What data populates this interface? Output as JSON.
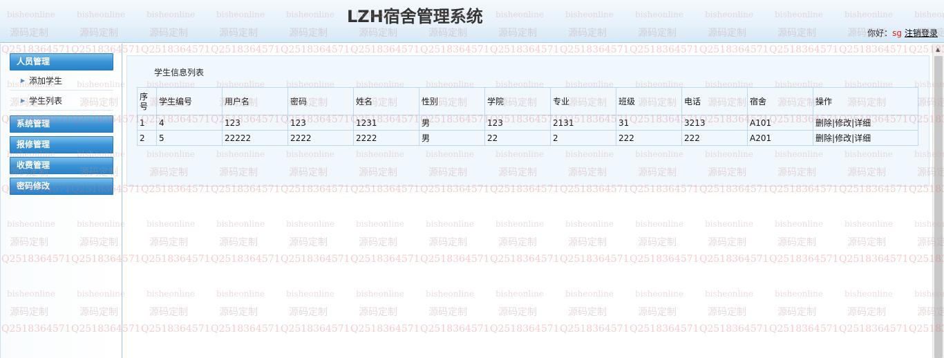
{
  "header": {
    "app_title": "LZH宿舍管理系统",
    "greeting": "你好：",
    "username": "sg",
    "logout_label": "注销登录"
  },
  "sidebar": {
    "groups": [
      {
        "label": "人员管理",
        "items": [
          {
            "label": "添加学生"
          },
          {
            "label": "学生列表"
          }
        ]
      },
      {
        "label": "系统管理"
      },
      {
        "label": "报修管理"
      },
      {
        "label": "收费管理"
      },
      {
        "label": "密码修改"
      }
    ]
  },
  "main": {
    "list_title": "学生信息列表",
    "table": {
      "columns": [
        "序号",
        "学生编号",
        "用户名",
        "密码",
        "姓名",
        "性别",
        "学院",
        "专业",
        "班级",
        "电话",
        "宿舍",
        "操作"
      ],
      "rows": [
        [
          "1",
          "4",
          "123",
          "123",
          "1231",
          "男",
          "123",
          "2131",
          "31",
          "3213",
          "A101"
        ],
        [
          "2",
          "5",
          "22222",
          "2222",
          "2222",
          "男",
          "22",
          "2",
          "222",
          "222",
          "A201"
        ]
      ],
      "actions": {
        "delete": "删除",
        "edit": "修改",
        "detail": "详细",
        "separator": "|"
      }
    }
  },
  "watermark": {
    "line1": "bisheonline",
    "line2": "源码定制",
    "line3": "Q2518364571"
  },
  "colors": {
    "menu_header": "#3b94d6",
    "username": "#e0201e",
    "table_border": "#bcd8ec",
    "content_bg": "#f1f8fd"
  }
}
